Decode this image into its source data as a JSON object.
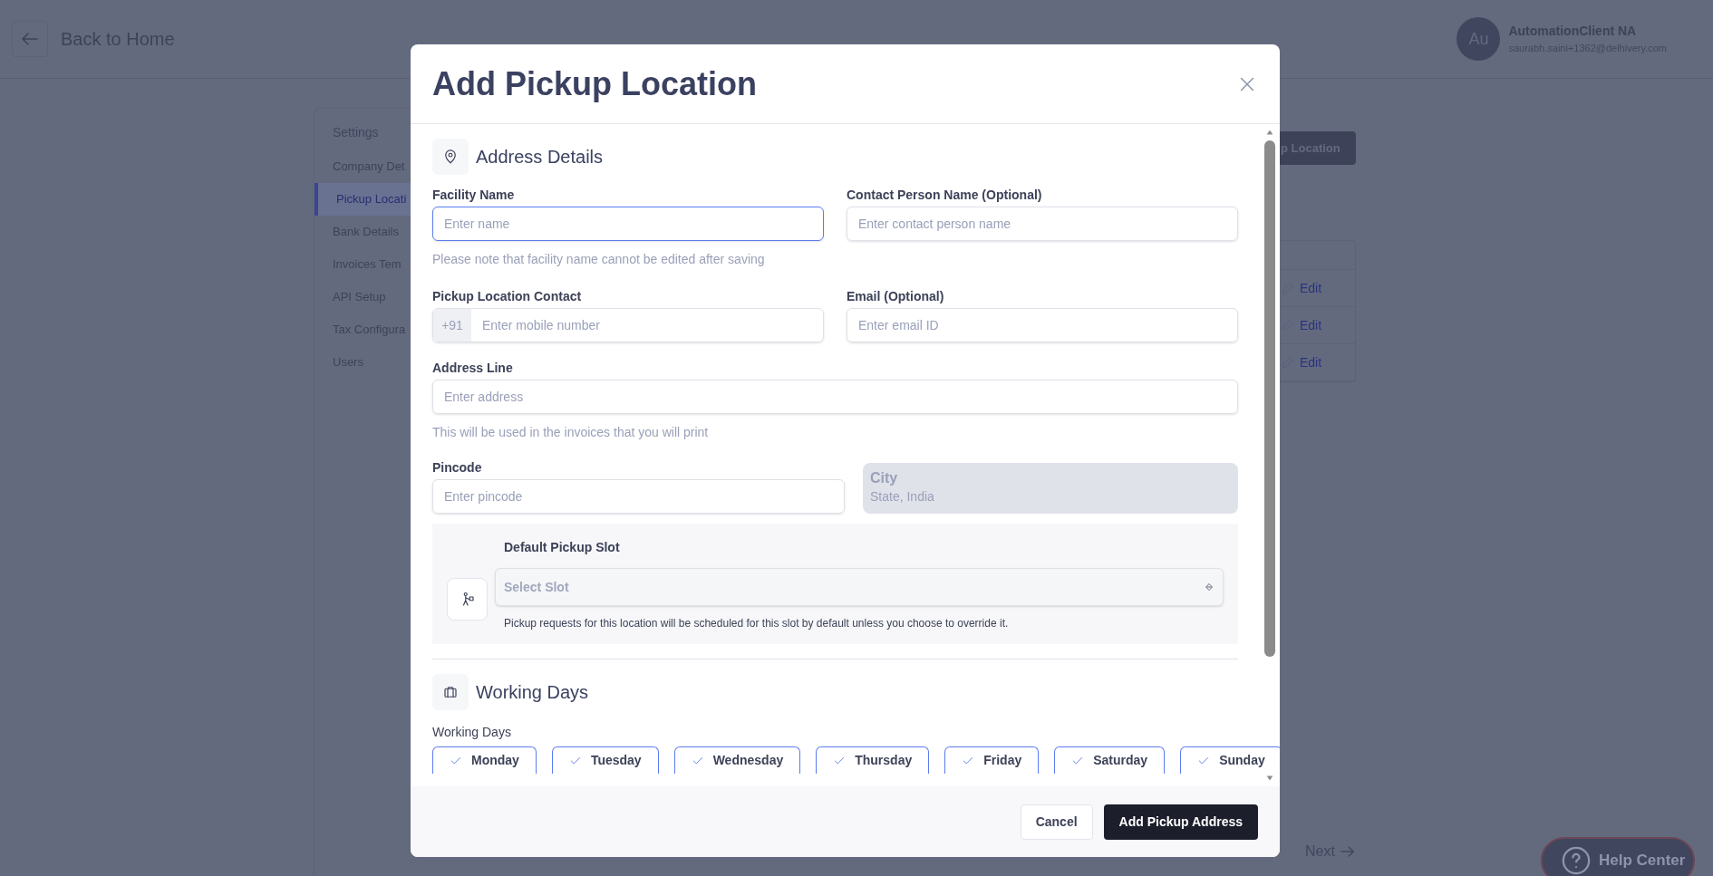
{
  "header": {
    "back_button": {
      "label": "Back to Home"
    },
    "user": {
      "initials": "Au",
      "name": "AutomationClient NA",
      "email": "saurabh.saini+1362@delhivery.com"
    }
  },
  "sidebar": {
    "heading": "Settings",
    "items": [
      {
        "label": "Company Det",
        "selected": false
      },
      {
        "label": "Pickup Locati",
        "selected": true
      },
      {
        "label": "Bank Details",
        "selected": false
      },
      {
        "label": "Invoices Tem",
        "selected": false
      },
      {
        "label": "API Setup",
        "selected": false
      },
      {
        "label": "Tax Configura",
        "selected": false
      },
      {
        "label": "Users",
        "selected": false
      }
    ]
  },
  "content": {
    "add_button": {
      "label": "p Location"
    },
    "rows": [
      {
        "action": "Edit"
      },
      {
        "action": "Edit"
      },
      {
        "action": "Edit"
      }
    ],
    "pagination": {
      "next": "Next"
    }
  },
  "help_button": {
    "label": "Help Center"
  },
  "modal": {
    "title": "Add Pickup Location",
    "address_section": {
      "title": "Address Details"
    },
    "facility_name": {
      "label": "Facility Name",
      "placeholder": "Enter name",
      "hint": "Please note that facility name cannot be edited after saving",
      "focused": true
    },
    "contact_person": {
      "label": "Contact Person Name (Optional)",
      "placeholder": "Enter contact person name",
      "focused": false
    },
    "pickup_contact": {
      "label": "Pickup Location Contact",
      "prefix": "+91",
      "placeholder": "Enter mobile number"
    },
    "email": {
      "label": "Email (Optional)",
      "placeholder": "Enter email ID",
      "focused": false
    },
    "address_line": {
      "label": "Address Line",
      "placeholder": "Enter address",
      "hint": "This will be used in the invoices that you will print",
      "focused": false
    },
    "pincode": {
      "label": "Pincode",
      "placeholder": "Enter pincode",
      "focused": false
    },
    "city": {
      "label": "City",
      "value": "State, India",
      "disabled": true
    },
    "pickup_slot": {
      "label": "Default Pickup Slot",
      "placeholder": "Select Slot",
      "note": "Pickup requests for this location will be scheduled for this slot by default unless you choose to override it."
    },
    "working_days_section": {
      "title": "Working Days",
      "label": "Working Days",
      "days": [
        {
          "label": "Monday",
          "selected": true
        },
        {
          "label": "Tuesday",
          "selected": true
        },
        {
          "label": "Wednesday",
          "selected": true
        },
        {
          "label": "Thursday",
          "selected": true
        },
        {
          "label": "Friday",
          "selected": true
        },
        {
          "label": "Saturday",
          "selected": true
        },
        {
          "label": "Sunday",
          "selected": true
        }
      ]
    },
    "buttons": {
      "cancel": "Cancel",
      "submit": "Add Pickup Address"
    }
  }
}
